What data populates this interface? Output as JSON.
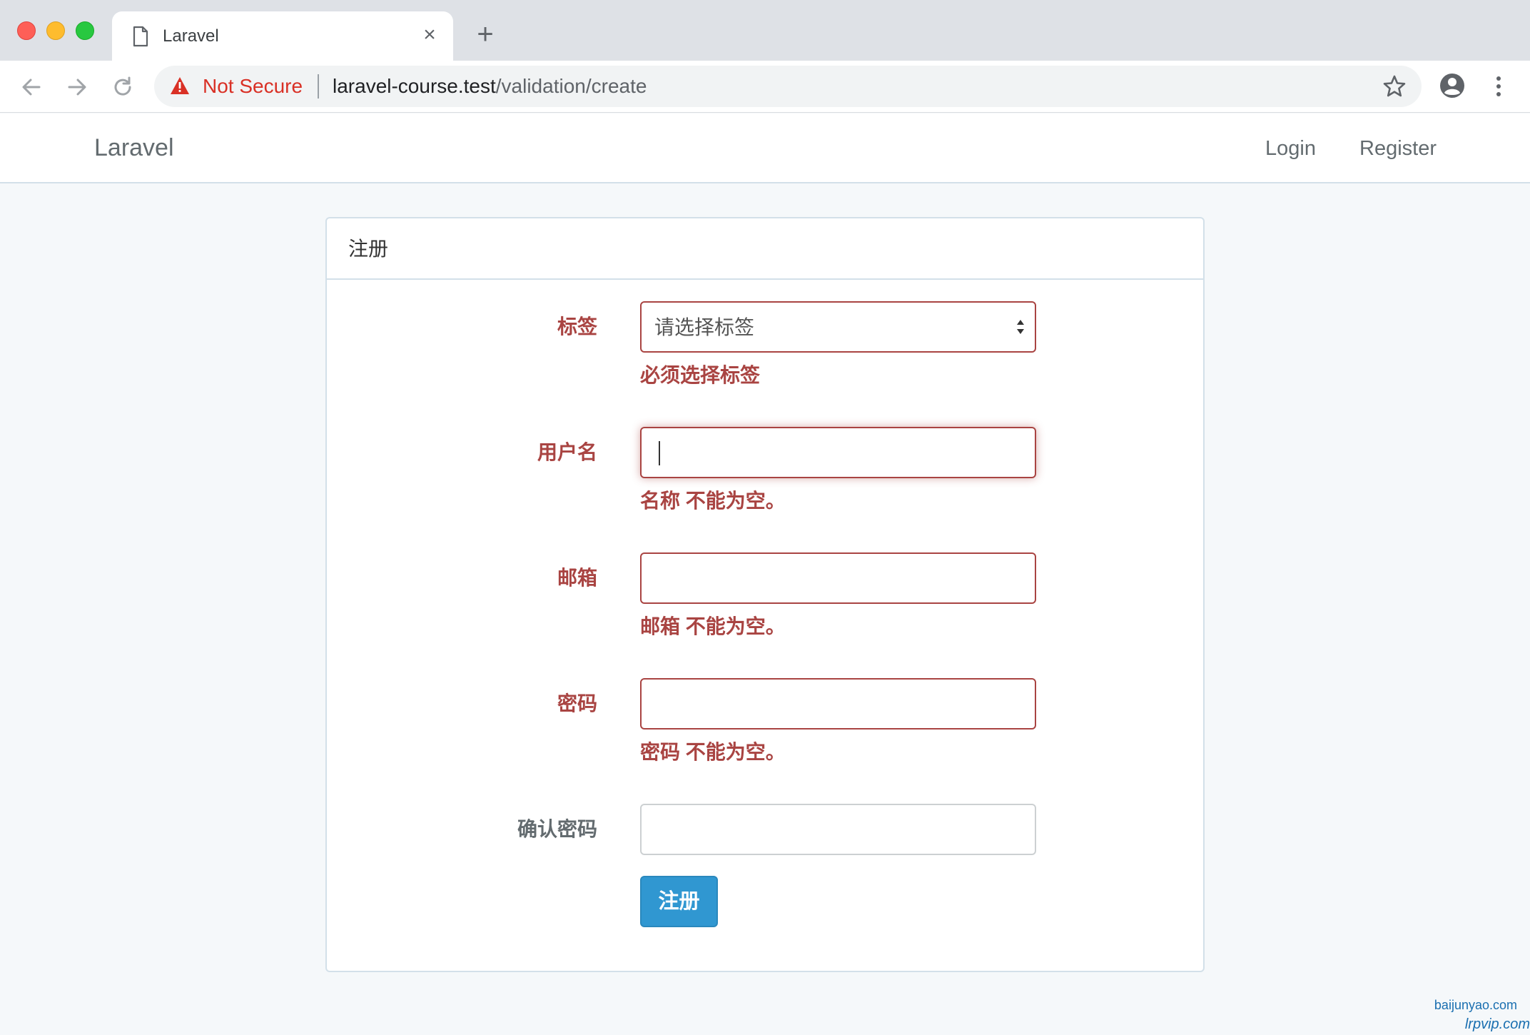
{
  "browser": {
    "tab_title": "Laravel",
    "tab_close_icon": "×",
    "new_tab_icon": "+",
    "security_label": "Not Secure",
    "url_host": "laravel-course.test",
    "url_path": "/validation/create"
  },
  "navbar": {
    "brand": "Laravel",
    "login": "Login",
    "register": "Register"
  },
  "form": {
    "panel_title": "注册",
    "tag": {
      "label": "标签",
      "selected": "请选择标签",
      "error": "必须选择标签"
    },
    "username": {
      "label": "用户名",
      "value": "",
      "error": "名称 不能为空。"
    },
    "email": {
      "label": "邮箱",
      "value": "",
      "error": "邮箱 不能为空。"
    },
    "password": {
      "label": "密码",
      "value": "",
      "error": "密码 不能为空。"
    },
    "password_confirm": {
      "label": "确认密码",
      "value": ""
    },
    "submit_label": "注册"
  },
  "watermark": {
    "line1": "baijunyao.com",
    "line2": "lrpvip.com"
  },
  "colors": {
    "error": "#a94442",
    "primary": "#3097d1",
    "page_bg": "#f5f8fa",
    "warning_red": "#d93025"
  }
}
